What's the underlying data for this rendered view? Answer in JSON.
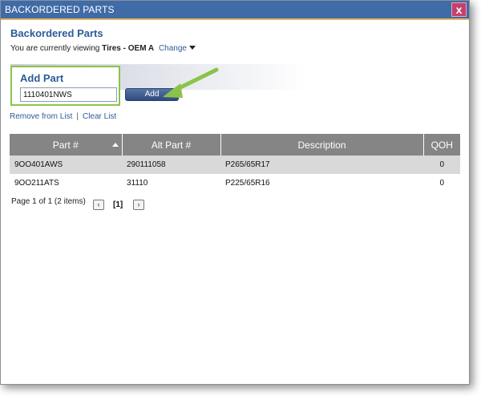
{
  "window": {
    "title": "BACKORDERED PARTS",
    "close_label": "x"
  },
  "header": {
    "title": "Backordered Parts",
    "viewing_prefix": "You are currently viewing",
    "viewing_value": "Tires - OEM A",
    "change_label": "Change"
  },
  "add_part": {
    "title": "Add Part",
    "input_value": "1110401NWS",
    "button_label": "Add"
  },
  "links": {
    "remove": "Remove from List",
    "clear": "Clear List"
  },
  "table": {
    "columns": [
      "Part #",
      "Alt Part #",
      "Description",
      "QOH"
    ],
    "rows": [
      {
        "part": "9OO401AWS",
        "alt": "290111058",
        "desc": "P265/65R17",
        "qoh": "0"
      },
      {
        "part": "9OO211ATS",
        "alt": "31110",
        "desc": "P225/65R16",
        "qoh": "0"
      }
    ]
  },
  "pager": {
    "summary": "Page 1 of 1 (2 items)",
    "current": "[1]"
  },
  "colors": {
    "title_bar": "#3f6ba6",
    "accent_text": "#2d5b98",
    "highlight_box": "#8bc34a",
    "header_bg": "#858585"
  }
}
